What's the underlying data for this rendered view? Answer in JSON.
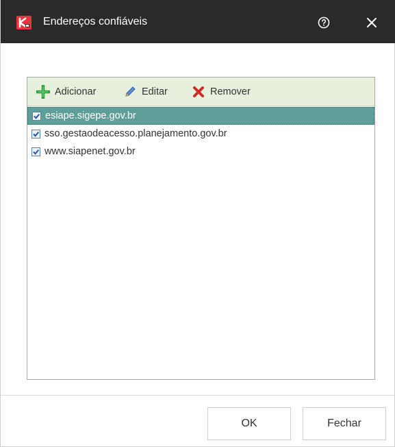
{
  "window": {
    "title": "Endereços confiáveis",
    "accent_color": "#5e9e98",
    "titlebar_color": "#2a2a2a"
  },
  "titlebar": {
    "help_icon": "help-circle-icon",
    "close_icon": "close-icon",
    "logo_icon": "kaspersky-logo-icon"
  },
  "toolbar": {
    "add_label": "Adicionar",
    "edit_label": "Editar",
    "remove_label": "Remover",
    "add_icon": "plus-icon",
    "edit_icon": "pencil-icon",
    "remove_icon": "x-icon"
  },
  "list": {
    "items": [
      {
        "label": "esiape.sigepe.gov.br",
        "checked": true,
        "selected": true
      },
      {
        "label": "sso.gestaodeacesso.planejamento.gov.br",
        "checked": true,
        "selected": false
      },
      {
        "label": "www.siapenet.gov.br",
        "checked": true,
        "selected": false
      }
    ]
  },
  "footer": {
    "ok_label": "OK",
    "close_label": "Fechar"
  }
}
